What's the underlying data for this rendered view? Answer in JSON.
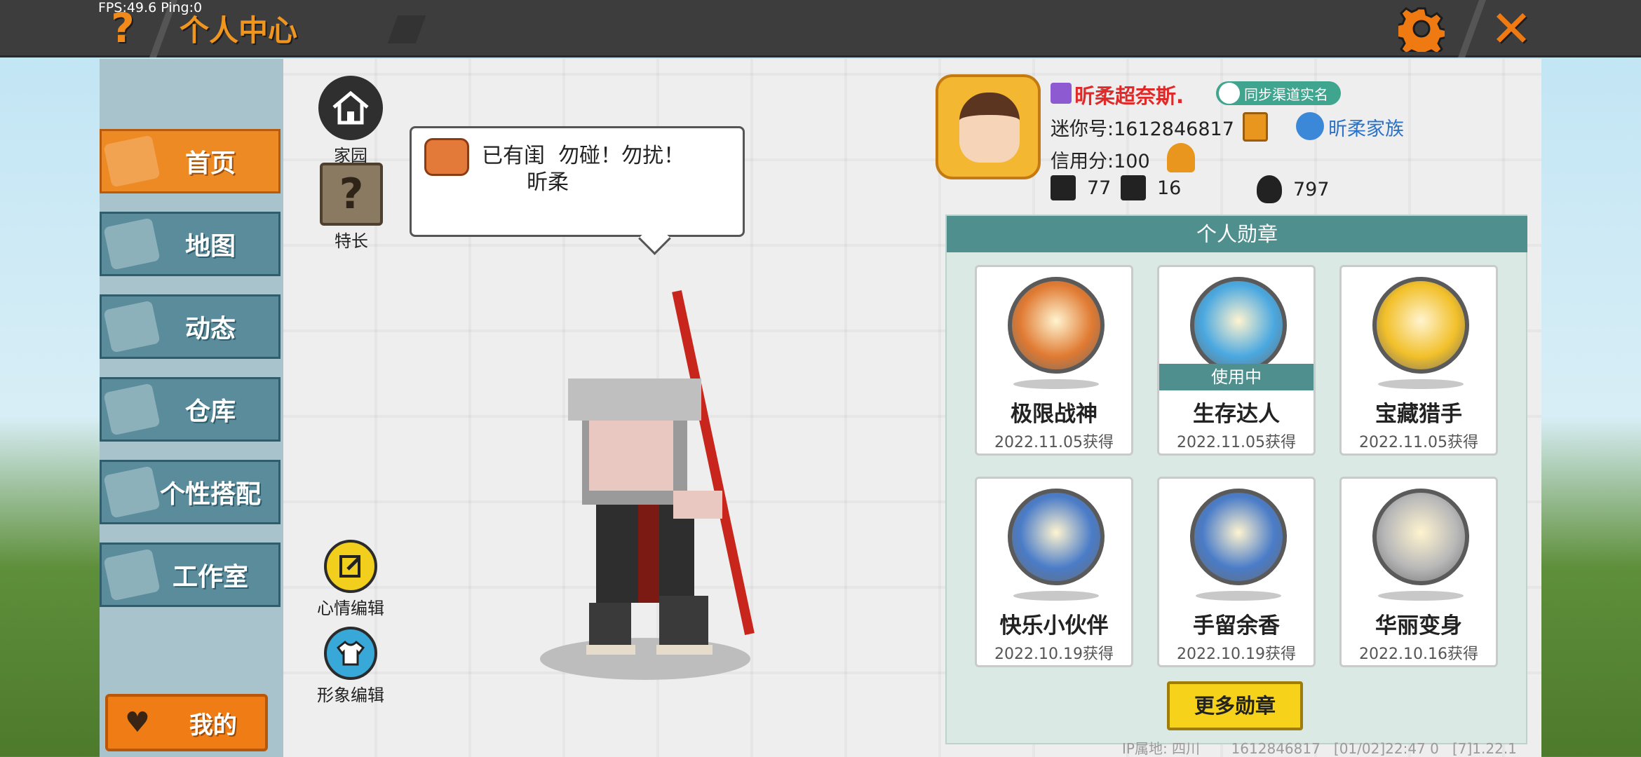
{
  "debug": {
    "fps_text": "FPS:49.6  Ping:0"
  },
  "header": {
    "title": "个人中心",
    "help_icon": "?",
    "close_icon": "✕"
  },
  "nav": {
    "items": [
      {
        "label": "首页",
        "icon": "home-icon",
        "active": true
      },
      {
        "label": "地图",
        "icon": "map-icon",
        "active": false
      },
      {
        "label": "动态",
        "icon": "bell-icon",
        "active": false
      },
      {
        "label": "仓库",
        "icon": "box-icon",
        "active": false
      },
      {
        "label": "个性搭配",
        "icon": "outfit-icon",
        "active": false
      },
      {
        "label": "工作室",
        "icon": "studio-icon",
        "active": false
      }
    ],
    "mine_label": "我的"
  },
  "side": {
    "home": "家园",
    "talent": "特长",
    "mood_edit": "心情编辑",
    "avatar_edit": "形象编辑"
  },
  "speech": {
    "line1": "已有闺  勿碰！勿扰！",
    "line2": "昕柔"
  },
  "profile": {
    "username": "昕柔超奈斯.",
    "sync_label": "同步渠道实名",
    "mini_id": "迷你号:1612846817",
    "family": "昕柔家族",
    "credit": "信用分:100",
    "stats": {
      "a": "77",
      "b": "16",
      "popularity": "797"
    }
  },
  "badges": {
    "header": "个人勋章",
    "in_use_label": "使用中",
    "items": [
      {
        "name": "极限战神",
        "date": "2022.11.05获得",
        "color": "#e07a32",
        "in_use": false
      },
      {
        "name": "生存达人",
        "date": "2022.11.05获得",
        "color": "#4aa8e0",
        "in_use": true
      },
      {
        "name": "宝藏猎手",
        "date": "2022.11.05获得",
        "color": "#f2c02a",
        "in_use": false
      },
      {
        "name": "快乐小伙伴",
        "date": "2022.10.19获得",
        "color": "#4a7cc8",
        "in_use": false
      },
      {
        "name": "手留余香",
        "date": "2022.10.19获得",
        "color": "#4a7cc8",
        "in_use": false
      },
      {
        "name": "华丽变身",
        "date": "2022.10.16获得",
        "color": "#b8b8b8",
        "in_use": false
      }
    ],
    "more_label": "更多勋章"
  },
  "footer": {
    "ip": "IP属地: 四川",
    "uid": "1612846817",
    "time": "[01/02]22:47 0",
    "version": "[7]1.22.1"
  }
}
